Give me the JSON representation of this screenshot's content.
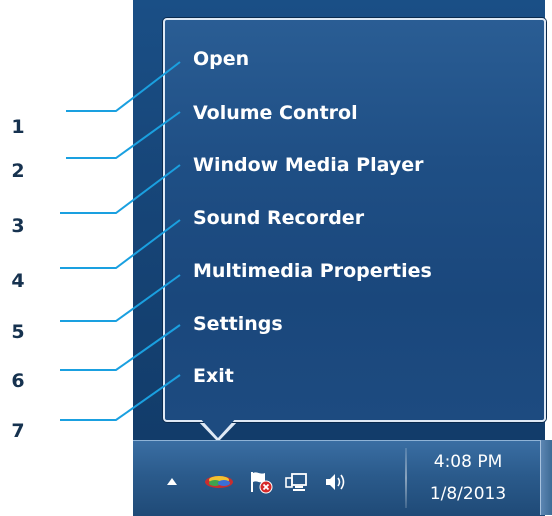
{
  "menu": {
    "items": [
      {
        "label": "Open"
      },
      {
        "label": "Volume Control"
      },
      {
        "label": "Window Media Player"
      },
      {
        "label": "Sound Recorder"
      },
      {
        "label": "Multimedia Properties"
      },
      {
        "label": "Settings"
      },
      {
        "label": "Exit"
      }
    ]
  },
  "callout_numbers": [
    "1",
    "2",
    "3",
    "4",
    "5",
    "6",
    "7"
  ],
  "taskbar": {
    "icons": [
      "show-hidden-icons-arrow",
      "audio-app-icon",
      "action-center-flag-icon",
      "network-icon",
      "speaker-volume-icon"
    ],
    "clock_time": "4:08 PM",
    "clock_date": "1/8/2013"
  },
  "colors": {
    "menu_background": "#1f4f85",
    "menu_border": "#dfe9f5",
    "callout_line": "#1aa0e0",
    "number_label": "#16324f"
  }
}
